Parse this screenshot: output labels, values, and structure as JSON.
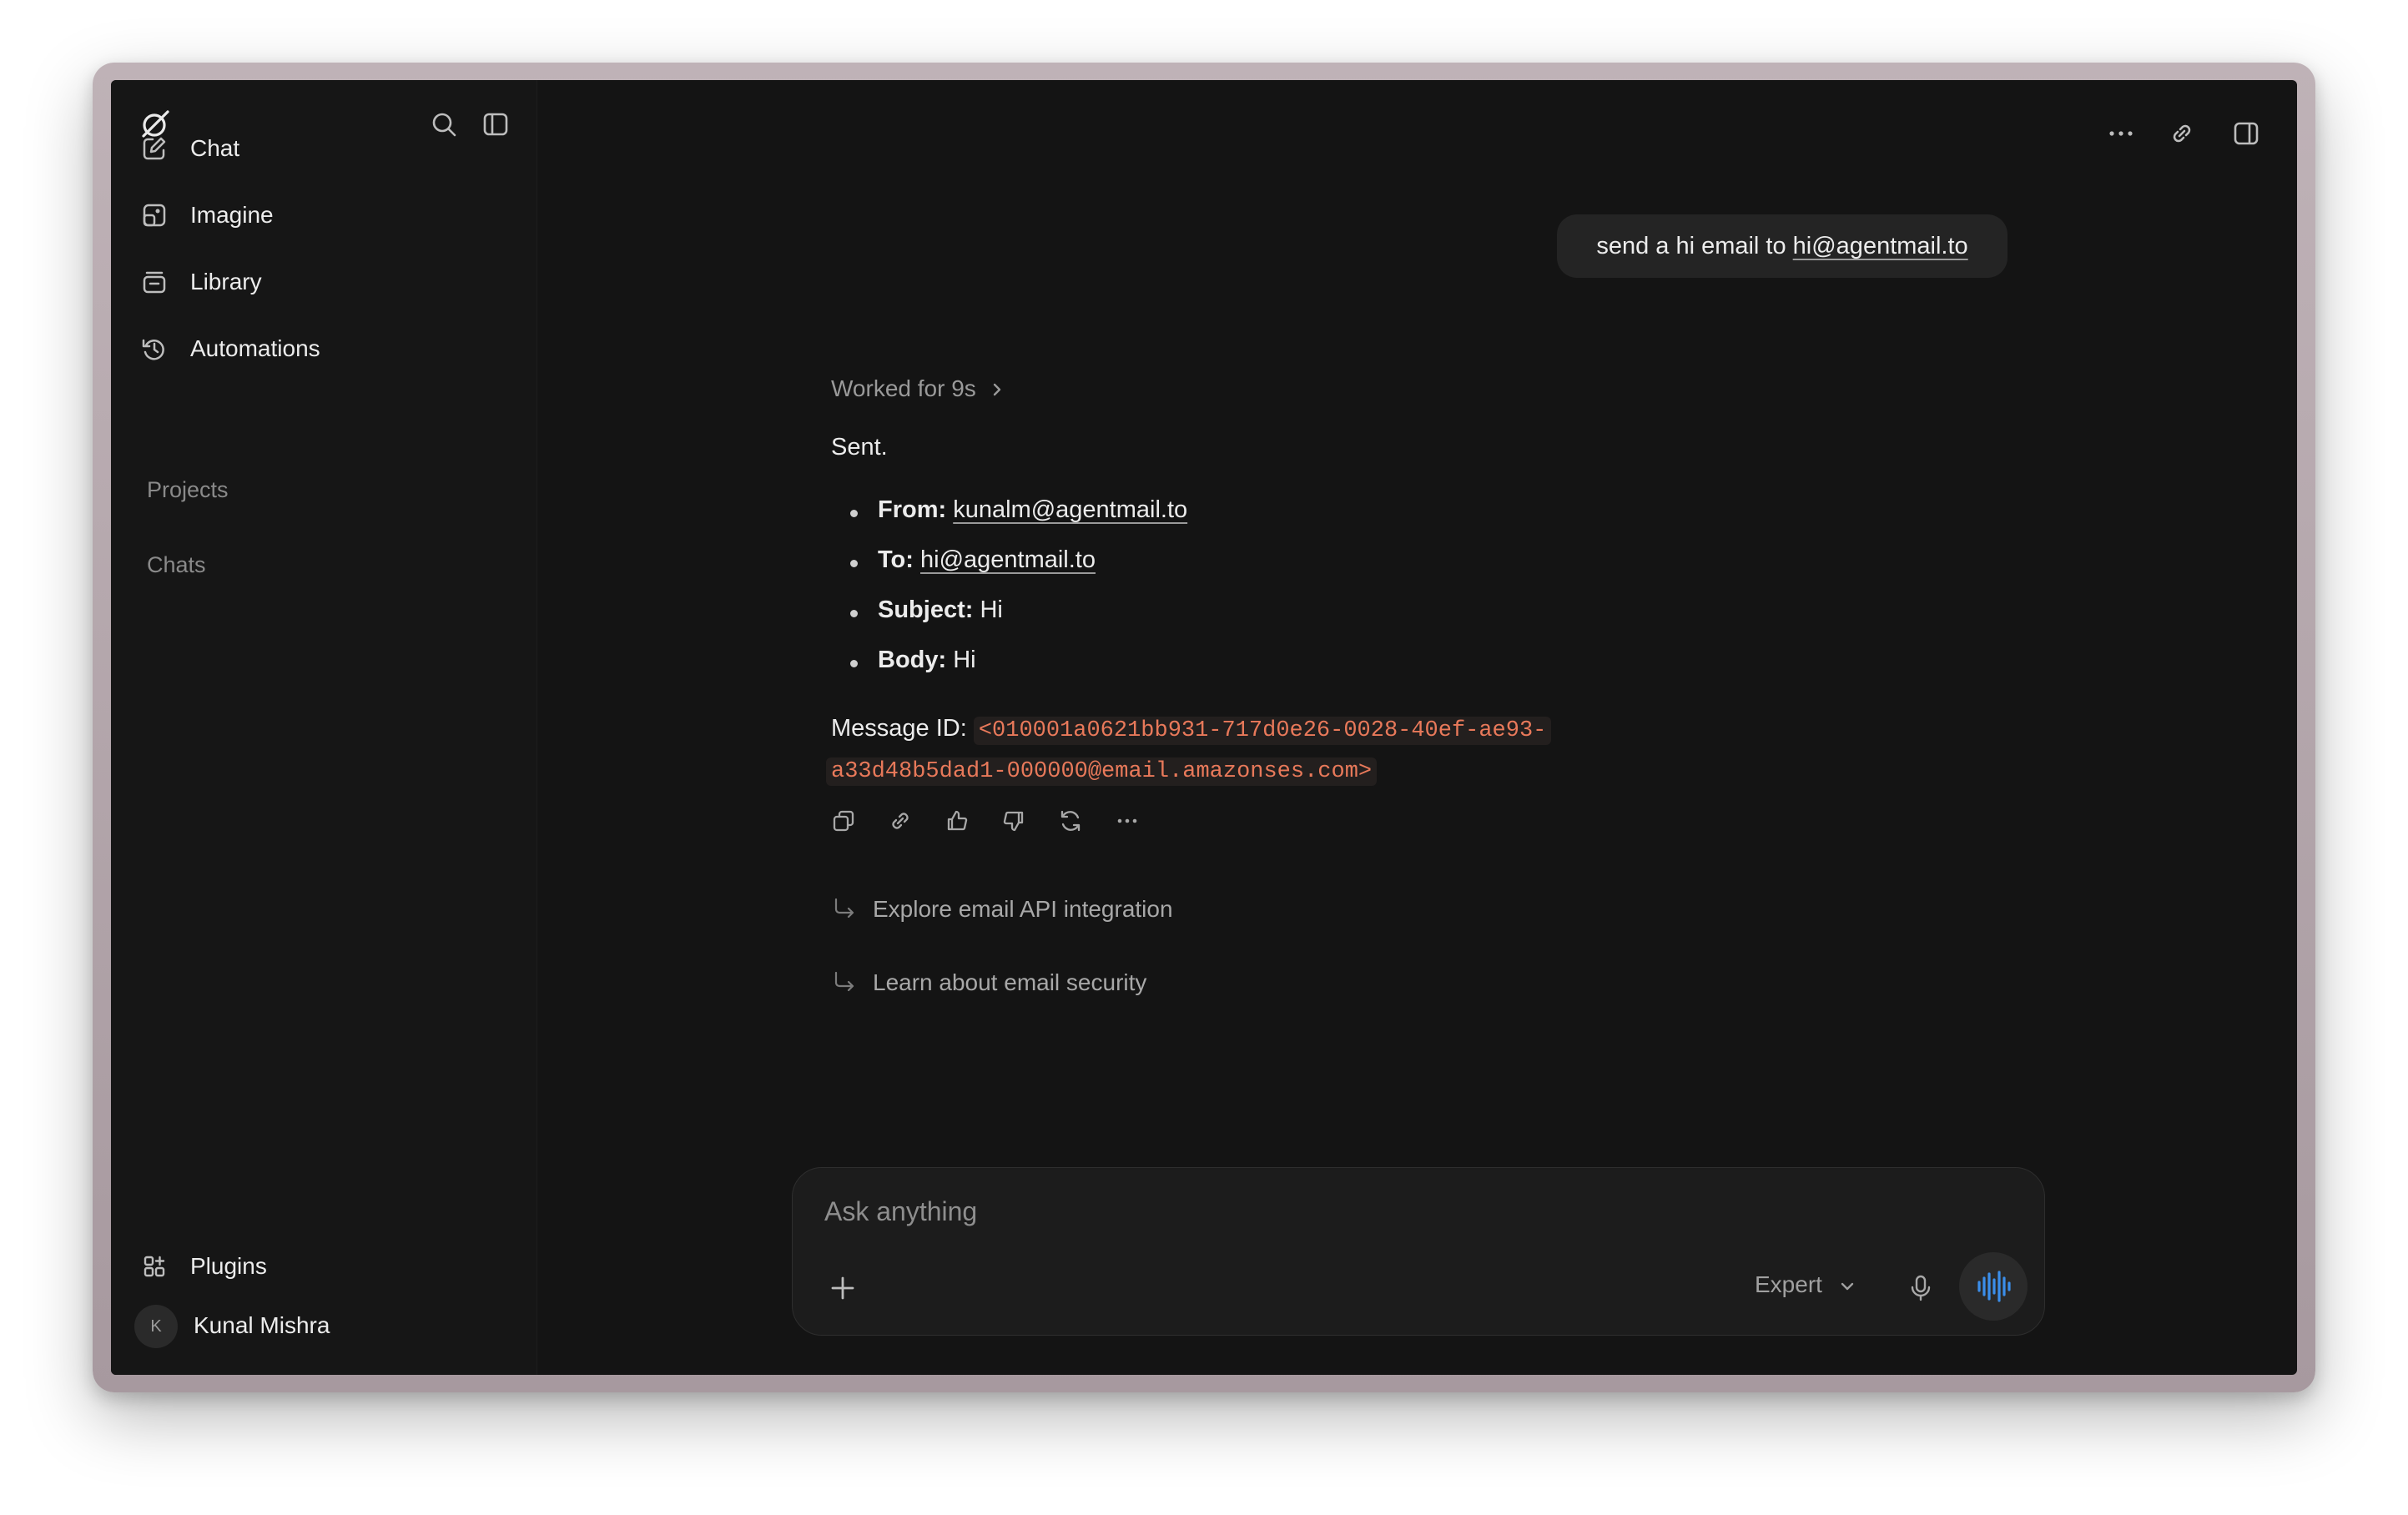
{
  "sidebar": {
    "nav": [
      {
        "label": "Chat",
        "icon": "edit-icon"
      },
      {
        "label": "Imagine",
        "icon": "image-icon"
      },
      {
        "label": "Library",
        "icon": "library-icon"
      },
      {
        "label": "Automations",
        "icon": "clock-history-icon"
      }
    ],
    "projects_label": "Projects",
    "chats_label": "Chats",
    "plugins_label": "Plugins",
    "user": {
      "initial": "K",
      "name": "Kunal Mishra"
    }
  },
  "conversation": {
    "user_message_prefix": "send a hi email to ",
    "user_message_link": "hi@agentmail.to",
    "worked_for": "Worked for 9s",
    "reply_intro": "Sent.",
    "fields": [
      {
        "key": "From:",
        "value": "kunalm@agentmail.to",
        "link": true
      },
      {
        "key": "To:",
        "value": "hi@agentmail.to",
        "link": true
      },
      {
        "key": "Subject:",
        "value": "Hi",
        "link": false
      },
      {
        "key": "Body:",
        "value": "Hi",
        "link": false
      }
    ],
    "message_id_label": "Message ID:",
    "message_id_line1": "<010001a0621bb931-717d0e26-0028-40ef-ae93-",
    "message_id_line2": "a33d48b5dad1-000000@email.amazonses.com>",
    "suggestions": [
      "Explore email API integration",
      "Learn about email security"
    ]
  },
  "composer": {
    "placeholder": "Ask anything",
    "mode": "Expert"
  },
  "colors": {
    "background": "#141414",
    "sidebar": "#161616",
    "code_accent": "#e8795a",
    "voice_accent": "#3b8eea"
  }
}
